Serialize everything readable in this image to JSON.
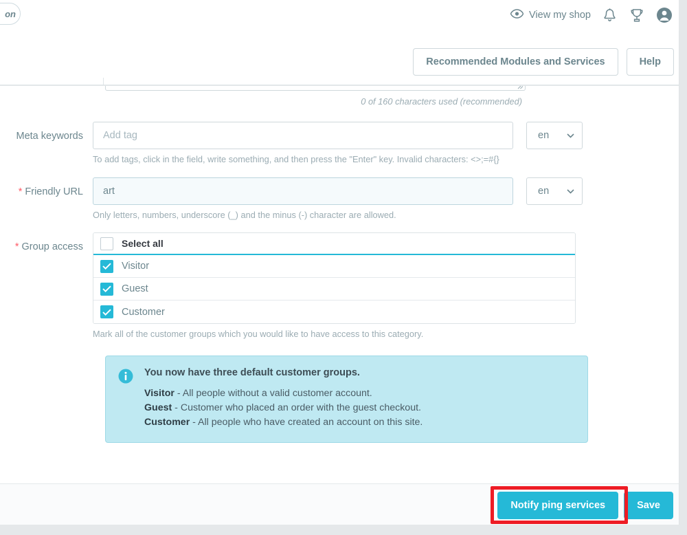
{
  "header": {
    "view_shop_label": "View my shop",
    "icons": [
      "eye-icon",
      "bell-icon",
      "trophy-icon",
      "account-icon"
    ],
    "corner_pill_text": "on"
  },
  "toolbar": {
    "recommended_modules_label": "Recommended Modules and Services",
    "help_label": "Help"
  },
  "form": {
    "meta_description_charcount": "0 of 160 characters used (recommended)",
    "meta_keywords": {
      "label": "Meta keywords",
      "placeholder": "Add tag",
      "value": "",
      "lang": "en",
      "help": "To add tags, click in the field, write something, and then press the \"Enter\" key. Invalid characters: <>;=#{}"
    },
    "friendly_url": {
      "label": "Friendly URL",
      "required": true,
      "value": "art",
      "placeholder": "",
      "lang": "en",
      "help": "Only letters, numbers, underscore (_) and the minus (-) character are allowed."
    },
    "group_access": {
      "label": "Group access",
      "required": true,
      "select_all_label": "Select all",
      "select_all_checked": false,
      "rows": [
        {
          "label": "Visitor",
          "checked": true
        },
        {
          "label": "Guest",
          "checked": true
        },
        {
          "label": "Customer",
          "checked": true
        }
      ],
      "help": "Mark all of the customer groups which you would like to have access to this category."
    }
  },
  "alert": {
    "icon": "info-circle-icon",
    "title": "You now have three default customer groups.",
    "lines": [
      {
        "term": "Visitor",
        "desc": " - All people without a valid customer account."
      },
      {
        "term": "Guest",
        "desc": " - Customer who placed an order with the guest checkout."
      },
      {
        "term": "Customer",
        "desc": " - All people who have created an account on this site."
      }
    ]
  },
  "footer": {
    "notify_ping_label": "Notify ping services",
    "save_label": "Save"
  },
  "colors": {
    "accent": "#25b9d7",
    "alert_bg": "#bfe9f2",
    "required_star": "#ff5c68",
    "highlight": "#ee1c25",
    "text_muted": "#6c868e"
  }
}
